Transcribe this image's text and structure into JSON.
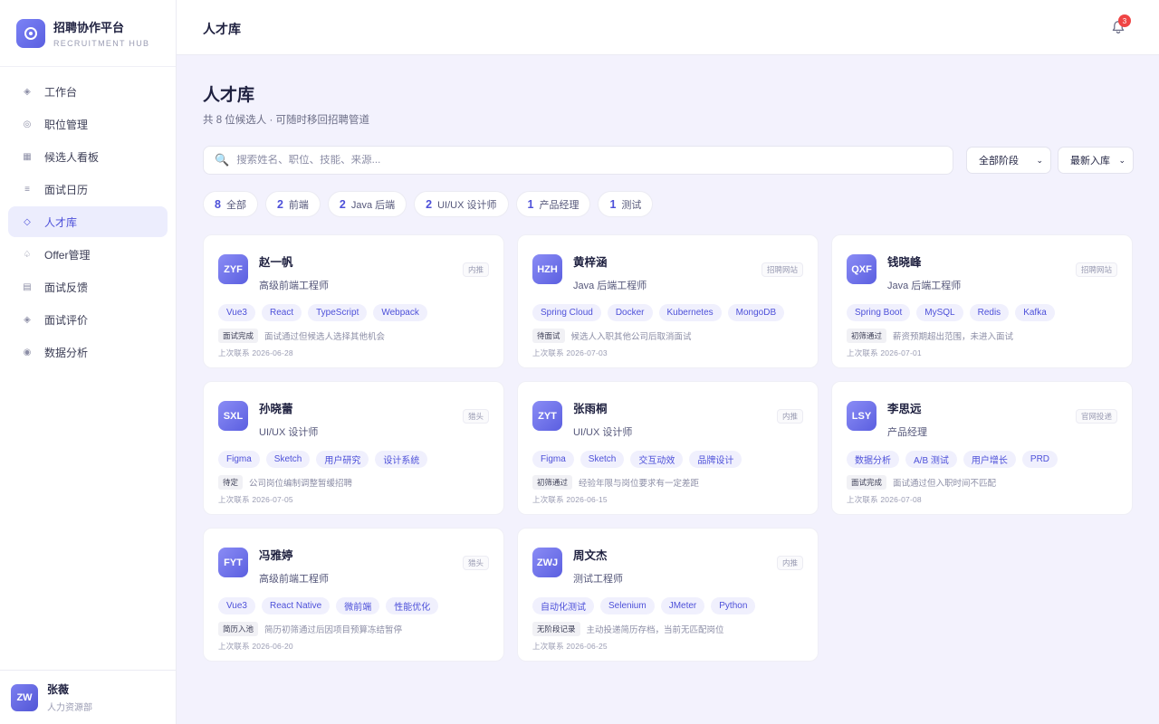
{
  "brand": {
    "name": "招聘协作平台",
    "subtitle": "RECRUITMENT HUB"
  },
  "nav": [
    {
      "label": "工作台",
      "icon": "diamond-icon",
      "glyph": "◈",
      "active": false
    },
    {
      "label": "职位管理",
      "icon": "target-icon",
      "glyph": "◎",
      "active": false
    },
    {
      "label": "候选人看板",
      "icon": "grid-icon",
      "glyph": "▦",
      "active": false
    },
    {
      "label": "面试日历",
      "icon": "list-icon",
      "glyph": "≡",
      "active": false
    },
    {
      "label": "人才库",
      "icon": "diamond-outline-icon",
      "glyph": "◇",
      "active": true
    },
    {
      "label": "Offer管理",
      "icon": "spade-icon",
      "glyph": "♤",
      "active": false
    },
    {
      "label": "面试反馈",
      "icon": "board-icon",
      "glyph": "▤",
      "active": false
    },
    {
      "label": "面试评价",
      "icon": "diamond-icon",
      "glyph": "◈",
      "active": false
    },
    {
      "label": "数据分析",
      "icon": "dot-circle-icon",
      "glyph": "◉",
      "active": false
    }
  ],
  "user": {
    "initials": "ZW",
    "name": "张薇",
    "department": "人力资源部"
  },
  "topbar": {
    "title": "人才库",
    "notification_count": "3"
  },
  "page": {
    "title": "人才库",
    "subtitle": "共 8 位候选人 · 可随时移回招聘管道"
  },
  "search": {
    "placeholder": "搜索姓名、职位、技能、来源...",
    "value": ""
  },
  "filters": {
    "stage": "全部阶段",
    "sort": "最新入库"
  },
  "chips": [
    {
      "count": "8",
      "label": "全部"
    },
    {
      "count": "2",
      "label": "前端"
    },
    {
      "count": "2",
      "label": "Java 后端"
    },
    {
      "count": "2",
      "label": "UI/UX 设计师"
    },
    {
      "count": "1",
      "label": "产品经理"
    },
    {
      "count": "1",
      "label": "测试"
    }
  ],
  "candidates": [
    {
      "initials": "ZYF",
      "name": "赵一帆",
      "title": "高级前端工程师",
      "source": "内推",
      "skills": [
        "Vue3",
        "React",
        "TypeScript",
        "Webpack"
      ],
      "stage": "面试完成",
      "note": "面试通过但候选人选择其他机会",
      "last_contact": "上次联系 2026-06-28"
    },
    {
      "initials": "HZH",
      "name": "黄梓涵",
      "title": "Java 后端工程师",
      "source": "招聘网站",
      "skills": [
        "Spring Cloud",
        "Docker",
        "Kubernetes",
        "MongoDB"
      ],
      "stage": "待面试",
      "note": "候选人入职其他公司后取消面试",
      "last_contact": "上次联系 2026-07-03"
    },
    {
      "initials": "QXF",
      "name": "钱晓峰",
      "title": "Java 后端工程师",
      "source": "招聘网站",
      "skills": [
        "Spring Boot",
        "MySQL",
        "Redis",
        "Kafka"
      ],
      "stage": "初筛通过",
      "note": "薪资预期超出范围，未进入面试",
      "last_contact": "上次联系 2026-07-01"
    },
    {
      "initials": "SXL",
      "name": "孙晓蕾",
      "title": "UI/UX 设计师",
      "source": "猎头",
      "skills": [
        "Figma",
        "Sketch",
        "用户研究",
        "设计系统"
      ],
      "stage": "待定",
      "note": "公司岗位编制调整暂缓招聘",
      "last_contact": "上次联系 2026-07-05"
    },
    {
      "initials": "ZYT",
      "name": "张雨桐",
      "title": "UI/UX 设计师",
      "source": "内推",
      "skills": [
        "Figma",
        "Sketch",
        "交互动效",
        "品牌设计"
      ],
      "stage": "初筛通过",
      "note": "经验年限与岗位要求有一定差距",
      "last_contact": "上次联系 2026-06-15"
    },
    {
      "initials": "LSY",
      "name": "李思远",
      "title": "产品经理",
      "source": "官网投递",
      "skills": [
        "数据分析",
        "A/B 测试",
        "用户增长",
        "PRD"
      ],
      "stage": "面试完成",
      "note": "面试通过但入职时间不匹配",
      "last_contact": "上次联系 2026-07-08"
    },
    {
      "initials": "FYT",
      "name": "冯雅婷",
      "title": "高级前端工程师",
      "source": "猎头",
      "skills": [
        "Vue3",
        "React Native",
        "微前端",
        "性能优化"
      ],
      "stage": "简历入池",
      "note": "简历初筛通过后因项目预算冻结暂停",
      "last_contact": "上次联系 2026-06-20"
    },
    {
      "initials": "ZWJ",
      "name": "周文杰",
      "title": "测试工程师",
      "source": "内推",
      "skills": [
        "自动化测试",
        "Selenium",
        "JMeter",
        "Python"
      ],
      "stage": "无阶段记录",
      "note": "主动投递简历存档，当前无匹配岗位",
      "last_contact": "上次联系 2026-06-25"
    }
  ],
  "colors": {
    "accent": "#4d50d9",
    "background": "#f3f2fd",
    "badge": "#ef4444"
  }
}
